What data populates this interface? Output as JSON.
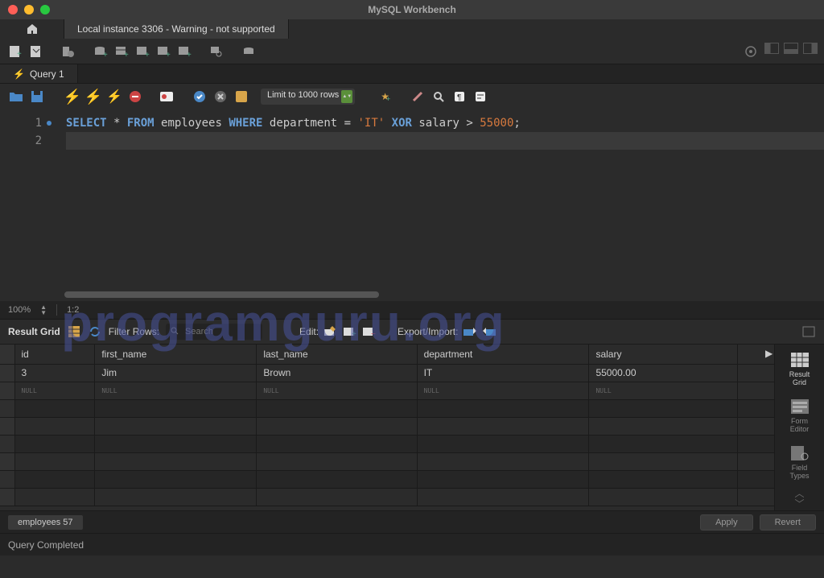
{
  "app_title": "MySQL Workbench",
  "connection_tab": "Local instance 3306 - Warning - not supported",
  "query_tab": "Query 1",
  "limit_select": "Limit to 1000 rows",
  "editor": {
    "line1_tokens": [
      "SELECT",
      " * ",
      "FROM",
      " employees ",
      "WHERE",
      " department = ",
      "'IT'",
      " ",
      "XOR",
      " salary > ",
      "55000",
      ";"
    ],
    "line_numbers": [
      "1",
      "2"
    ]
  },
  "zoom": {
    "percent": "100%",
    "pos": "1:2"
  },
  "result_toolbar": {
    "label": "Result Grid",
    "filter_label": "Filter Rows:",
    "filter_placeholder": "Search",
    "edit_label": "Edit:",
    "export_label": "Export/Import:"
  },
  "columns": [
    "id",
    "first_name",
    "last_name",
    "department",
    "salary"
  ],
  "rows": [
    [
      "3",
      "Jim",
      "Brown",
      "IT",
      "55000.00"
    ]
  ],
  "null_label": "NULL",
  "side": {
    "result_grid": "Result\nGrid",
    "form_editor": "Form\nEditor",
    "field_types": "Field\nTypes"
  },
  "result_tab_label": "employees 57",
  "apply_btn": "Apply",
  "revert_btn": "Revert",
  "status": "Query Completed",
  "watermark": "programguru.org"
}
